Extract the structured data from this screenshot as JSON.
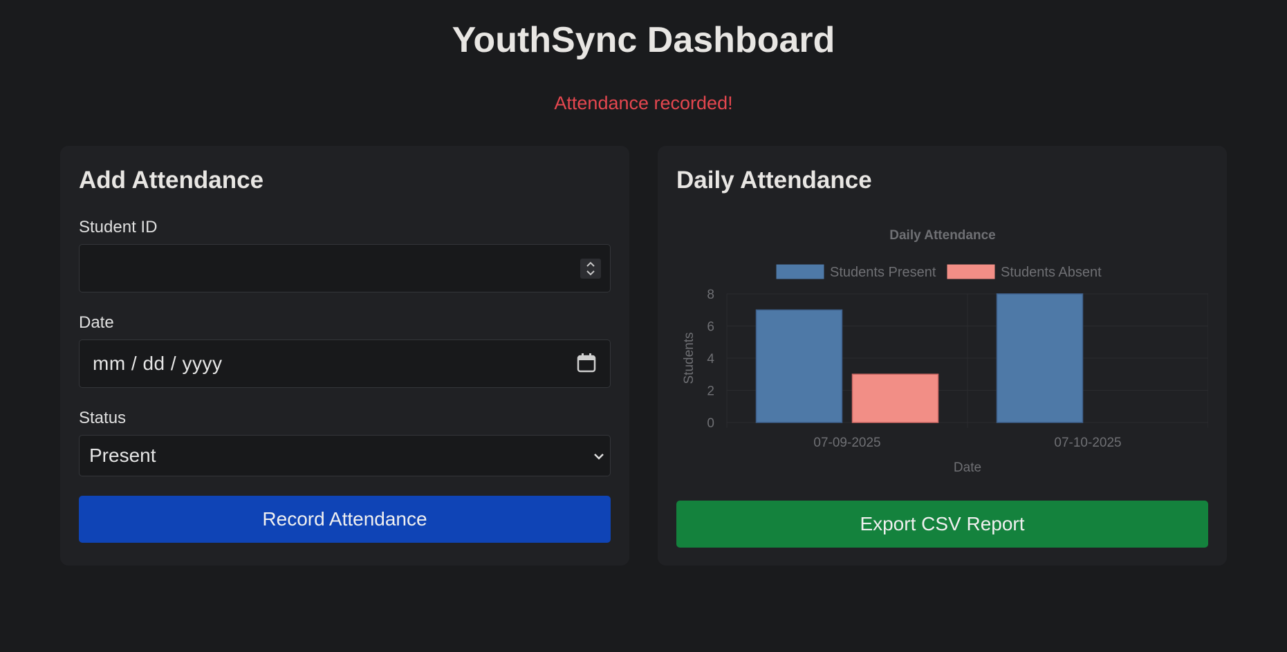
{
  "header": {
    "title": "YouthSync Dashboard",
    "flash_message": "Attendance recorded!"
  },
  "colors": {
    "page_bg": "#1a1b1d",
    "card_bg": "#202124",
    "flash": "#e5474f",
    "primary_button": "#0f44b6",
    "export_button": "#14823d",
    "present_bar": "#4e79a7",
    "absent_bar": "#f28e86"
  },
  "add_form": {
    "title": "Add Attendance",
    "student_id_label": "Student ID",
    "student_id_value": "",
    "date_label": "Date",
    "date_placeholder": "mm / dd / yyyy",
    "status_label": "Status",
    "status_value": "Present",
    "submit_label": "Record Attendance",
    "icons": [
      "number-spinner-icon",
      "calendar-icon",
      "chevron-down-icon"
    ]
  },
  "chart_panel": {
    "title": "Daily Attendance",
    "export_label": "Export CSV Report"
  },
  "chart_data": {
    "type": "bar",
    "title": "Daily Attendance",
    "categories": [
      "07-09-2025",
      "07-10-2025"
    ],
    "series": [
      {
        "name": "Students Present",
        "values": [
          7,
          8
        ],
        "color": "#4e79a7"
      },
      {
        "name": "Students Absent",
        "values": [
          3,
          0
        ],
        "color": "#f28e86"
      }
    ],
    "xlabel": "Date",
    "ylabel": "Students",
    "ylim": [
      0,
      8
    ],
    "yticks": [
      0,
      2,
      4,
      6,
      8
    ],
    "legend": "top",
    "grid": true
  }
}
